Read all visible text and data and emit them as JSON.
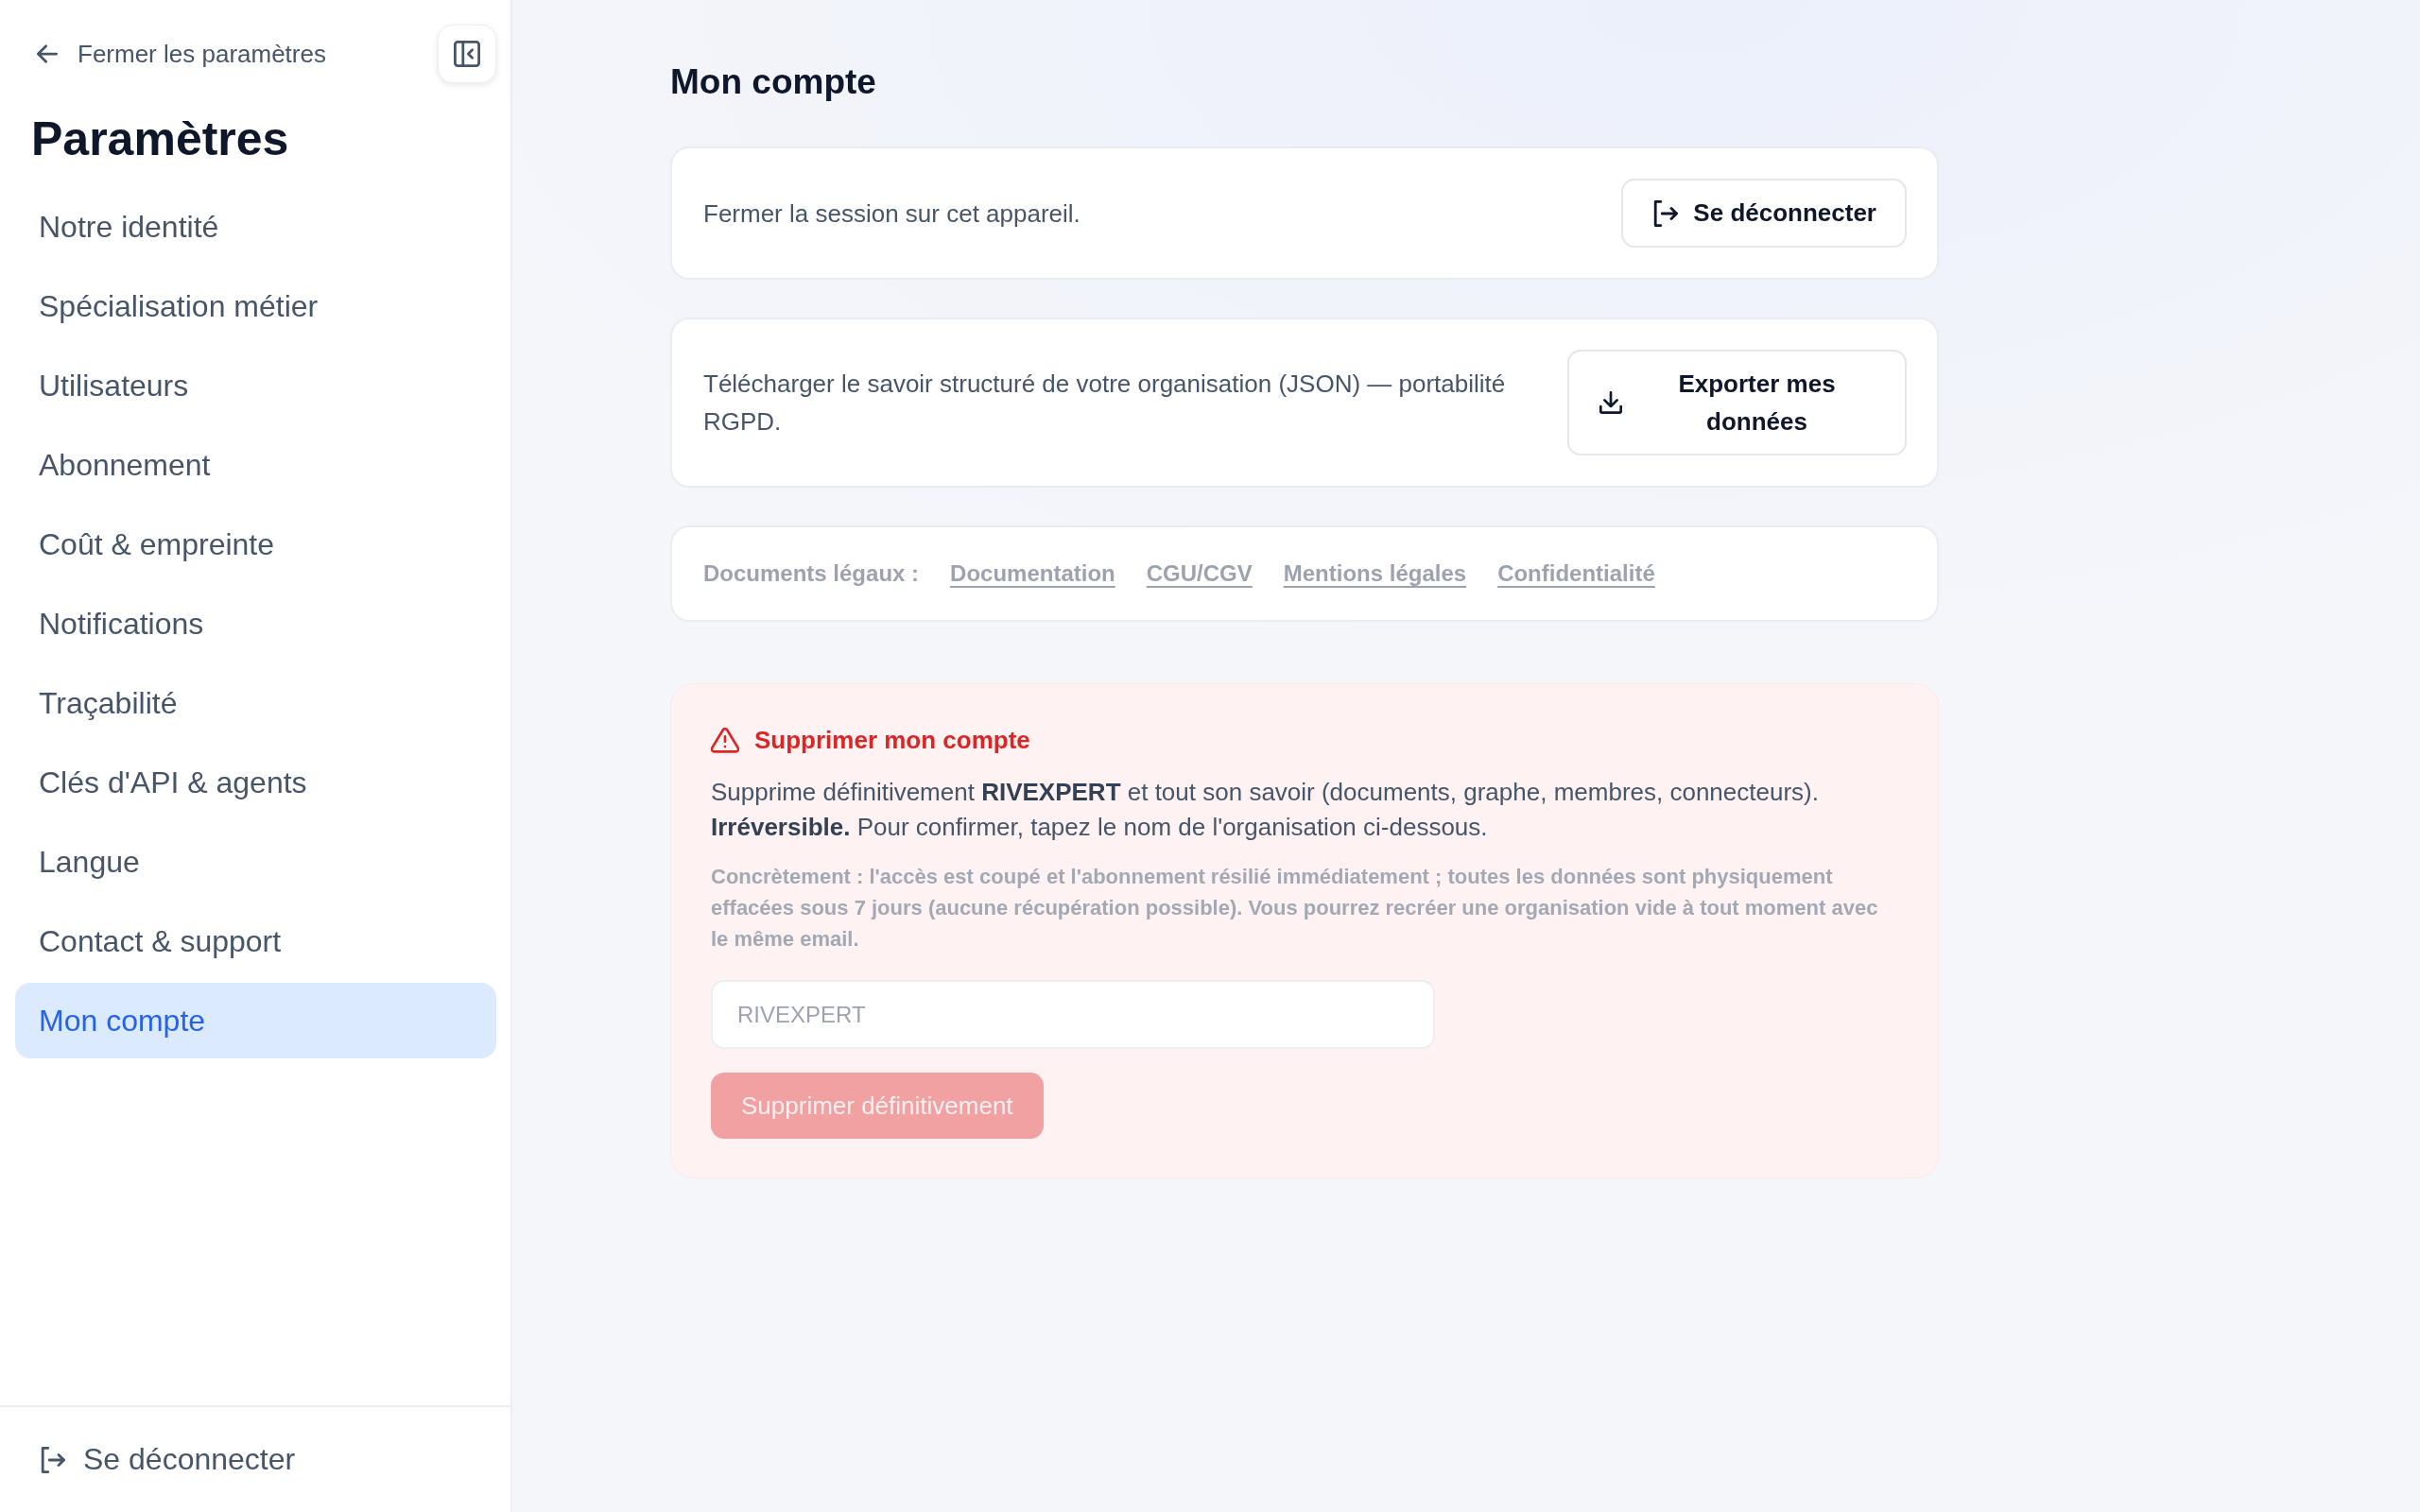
{
  "sidebar": {
    "back_link": {
      "label": "Fermer les paramètres"
    },
    "title": "Paramètres",
    "items": [
      {
        "label": "Notre identité",
        "selected": false
      },
      {
        "label": "Spécialisation métier",
        "selected": false
      },
      {
        "label": "Utilisateurs",
        "selected": false
      },
      {
        "label": "Abonnement",
        "selected": false
      },
      {
        "label": "Coût & empreinte",
        "selected": false
      },
      {
        "label": "Notifications",
        "selected": false
      },
      {
        "label": "Traçabilité",
        "selected": false
      },
      {
        "label": "Clés d'API & agents",
        "selected": false
      },
      {
        "label": "Langue",
        "selected": false
      },
      {
        "label": "Contact & support",
        "selected": false
      },
      {
        "label": "Mon compte",
        "selected": true
      }
    ],
    "logout_button": {
      "label": "Se déconnecter"
    }
  },
  "page": {
    "title": "Mon compte",
    "session_card": {
      "text": "Fermer la session sur cet appareil.",
      "button": {
        "label": "Se déconnecter"
      }
    },
    "export_card": {
      "text": "Télécharger le savoir structuré de votre organisation (JSON) — portabilité RGPD.",
      "button": {
        "label": "Exporter mes données"
      }
    },
    "legal_documents": {
      "label": "Documents légaux :",
      "links": [
        "Documentation",
        "CGU/CGV",
        "Mentions légales",
        "Confidentialité"
      ]
    },
    "danger_zone": {
      "title": "Supprimer mon compte",
      "description": "Supprime définitivement **RIVEXPERT** et tout son savoir (documents, graphe, membres, connecteurs). **Irréversible.** Pour confirmer, tapez le nom de l'organisation ci-dessous.",
      "note": "Concrètement : l'accès est coupé et l'abonnement résilié immédiatement ; toutes les données sont physiquement effacées sous 7 jours (aucune récupération possible). Vous pourrez recréer une organisation vide à tout moment avec le même email.",
      "confirm_field": {
        "placeholder": "RIVEXPERT"
      },
      "delete_button": {
        "label": "Supprimer définitivement",
        "disabled": true
      }
    }
  }
}
